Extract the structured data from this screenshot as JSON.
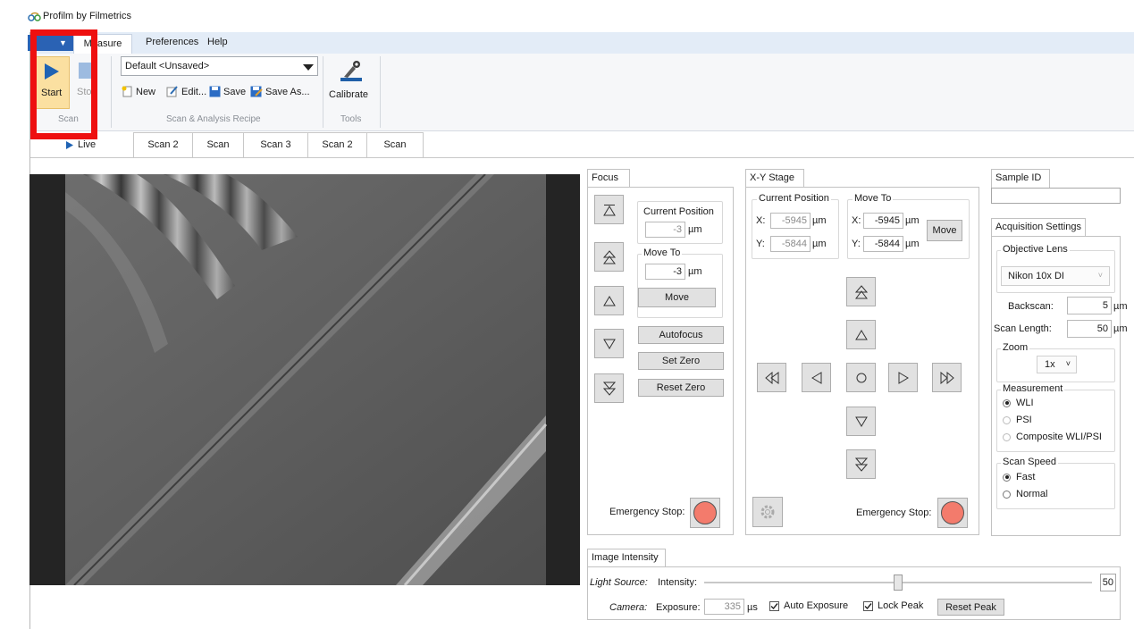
{
  "window": {
    "title": "Profilm by Filmetrics"
  },
  "menu": {
    "app_menu_glyph": "▼",
    "tabs": [
      "Measure",
      "Preferences",
      "Help"
    ]
  },
  "ribbon": {
    "scan_group": {
      "label": "Scan",
      "start_label": "Start",
      "stop_label": "Stop"
    },
    "recipe_group": {
      "label": "Scan & Analysis Recipe",
      "recipe_value": "Default <Unsaved>",
      "new_label": "New",
      "edit_label": "Edit...",
      "save_label": "Save",
      "save_as_label": "Save As..."
    },
    "tools_group": {
      "label": "Tools",
      "calibrate_label": "Calibrate"
    }
  },
  "doc_tabs": [
    "Live",
    "Scan 2",
    "Scan",
    "Scan 3",
    "Scan 2",
    "Scan"
  ],
  "focus": {
    "tab": "Focus",
    "current_position_label": "Current Position",
    "current_position_value": "-3",
    "move_to_label": "Move To",
    "move_to_value": "-3",
    "unit": "µm",
    "move_button": "Move",
    "autofocus_button": "Autofocus",
    "set_zero_button": "Set Zero",
    "reset_zero_button": "Reset Zero",
    "emergency_label": "Emergency Stop:"
  },
  "xy_stage": {
    "tab": "X-Y Stage",
    "current_position_label": "Current Position",
    "move_to_label": "Move To",
    "x_label": "X:",
    "y_label": "Y:",
    "current_x": "-5945",
    "current_y": "-5844",
    "move_x": "-5945",
    "move_y": "-5844",
    "unit": "µm",
    "move_button": "Move",
    "emergency_label": "Emergency Stop:"
  },
  "sample": {
    "tab": "Sample ID",
    "value": ""
  },
  "acquisition": {
    "tab": "Acquisition Settings",
    "objective_label": "Objective Lens",
    "objective_value": "Nikon 10x DI",
    "backscan_label": "Backscan:",
    "backscan_value": "5",
    "scan_length_label": "Scan Length:",
    "scan_length_value": "50",
    "unit": "µm",
    "zoom_label": "Zoom",
    "zoom_value": "1x",
    "measurement_label": "Measurement",
    "measurement_options": [
      "WLI",
      "PSI",
      "Composite WLI/PSI"
    ],
    "measurement_selected": "WLI",
    "speed_label": "Scan Speed",
    "speed_options": [
      "Fast",
      "Normal"
    ],
    "speed_selected": "Fast"
  },
  "intensity": {
    "tab": "Image Intensity",
    "light_source_label": "Light Source:",
    "intensity_label": "Intensity:",
    "intensity_value": "50",
    "intensity_fraction": 0.5,
    "camera_label": "Camera:",
    "exposure_label": "Exposure:",
    "exposure_value": "335",
    "exposure_unit": "µs",
    "auto_exposure_label": "Auto Exposure",
    "auto_exposure_checked": true,
    "lock_peak_label": "Lock Peak",
    "lock_peak_checked": true,
    "reset_peak_button": "Reset Peak"
  },
  "colors": {
    "highlight": "#ee1010",
    "estop": "#f37b6c",
    "start_active": "#fbe0a1",
    "accent": "#2a62b4"
  }
}
